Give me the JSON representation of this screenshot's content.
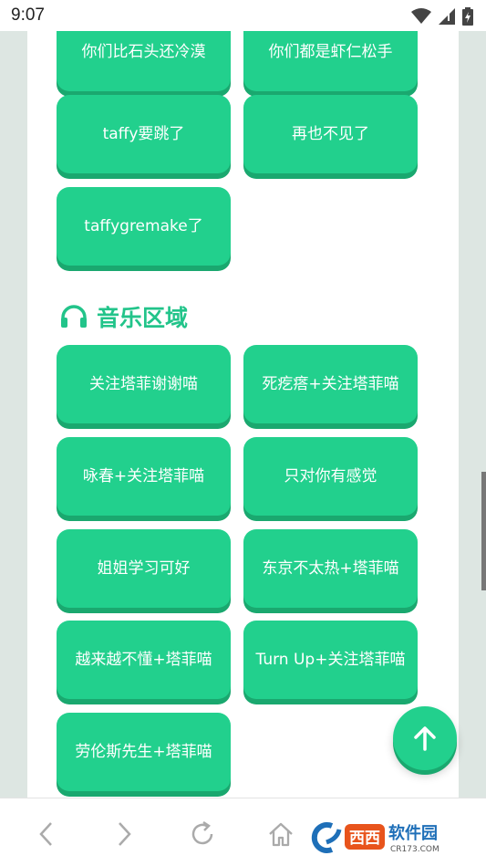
{
  "status": {
    "time": "9:07"
  },
  "buttons_top": [
    "你们比石头还冷漠",
    "你们都是虾仁松手",
    "taffy要跳了",
    "再也不见了",
    "taffygremake了"
  ],
  "music_section": {
    "title": "音乐区域",
    "buttons": [
      "关注塔菲谢谢喵",
      "死疙瘩+关注塔菲喵",
      "咏春+关注塔菲喵",
      "只对你有感觉",
      "姐姐学习可好",
      "东京不太热+塔菲喵",
      "越来越不懂+塔菲喵",
      "Turn Up+关注塔菲喵",
      "劳伦斯先生+塔菲喵"
    ]
  },
  "colors": {
    "accent": "#22d08d",
    "accent_dark": "#1aa86f",
    "title": "#22c48a"
  },
  "watermark": {
    "brand": "西西",
    "text": "软件园",
    "domain": "CR173.COM"
  }
}
